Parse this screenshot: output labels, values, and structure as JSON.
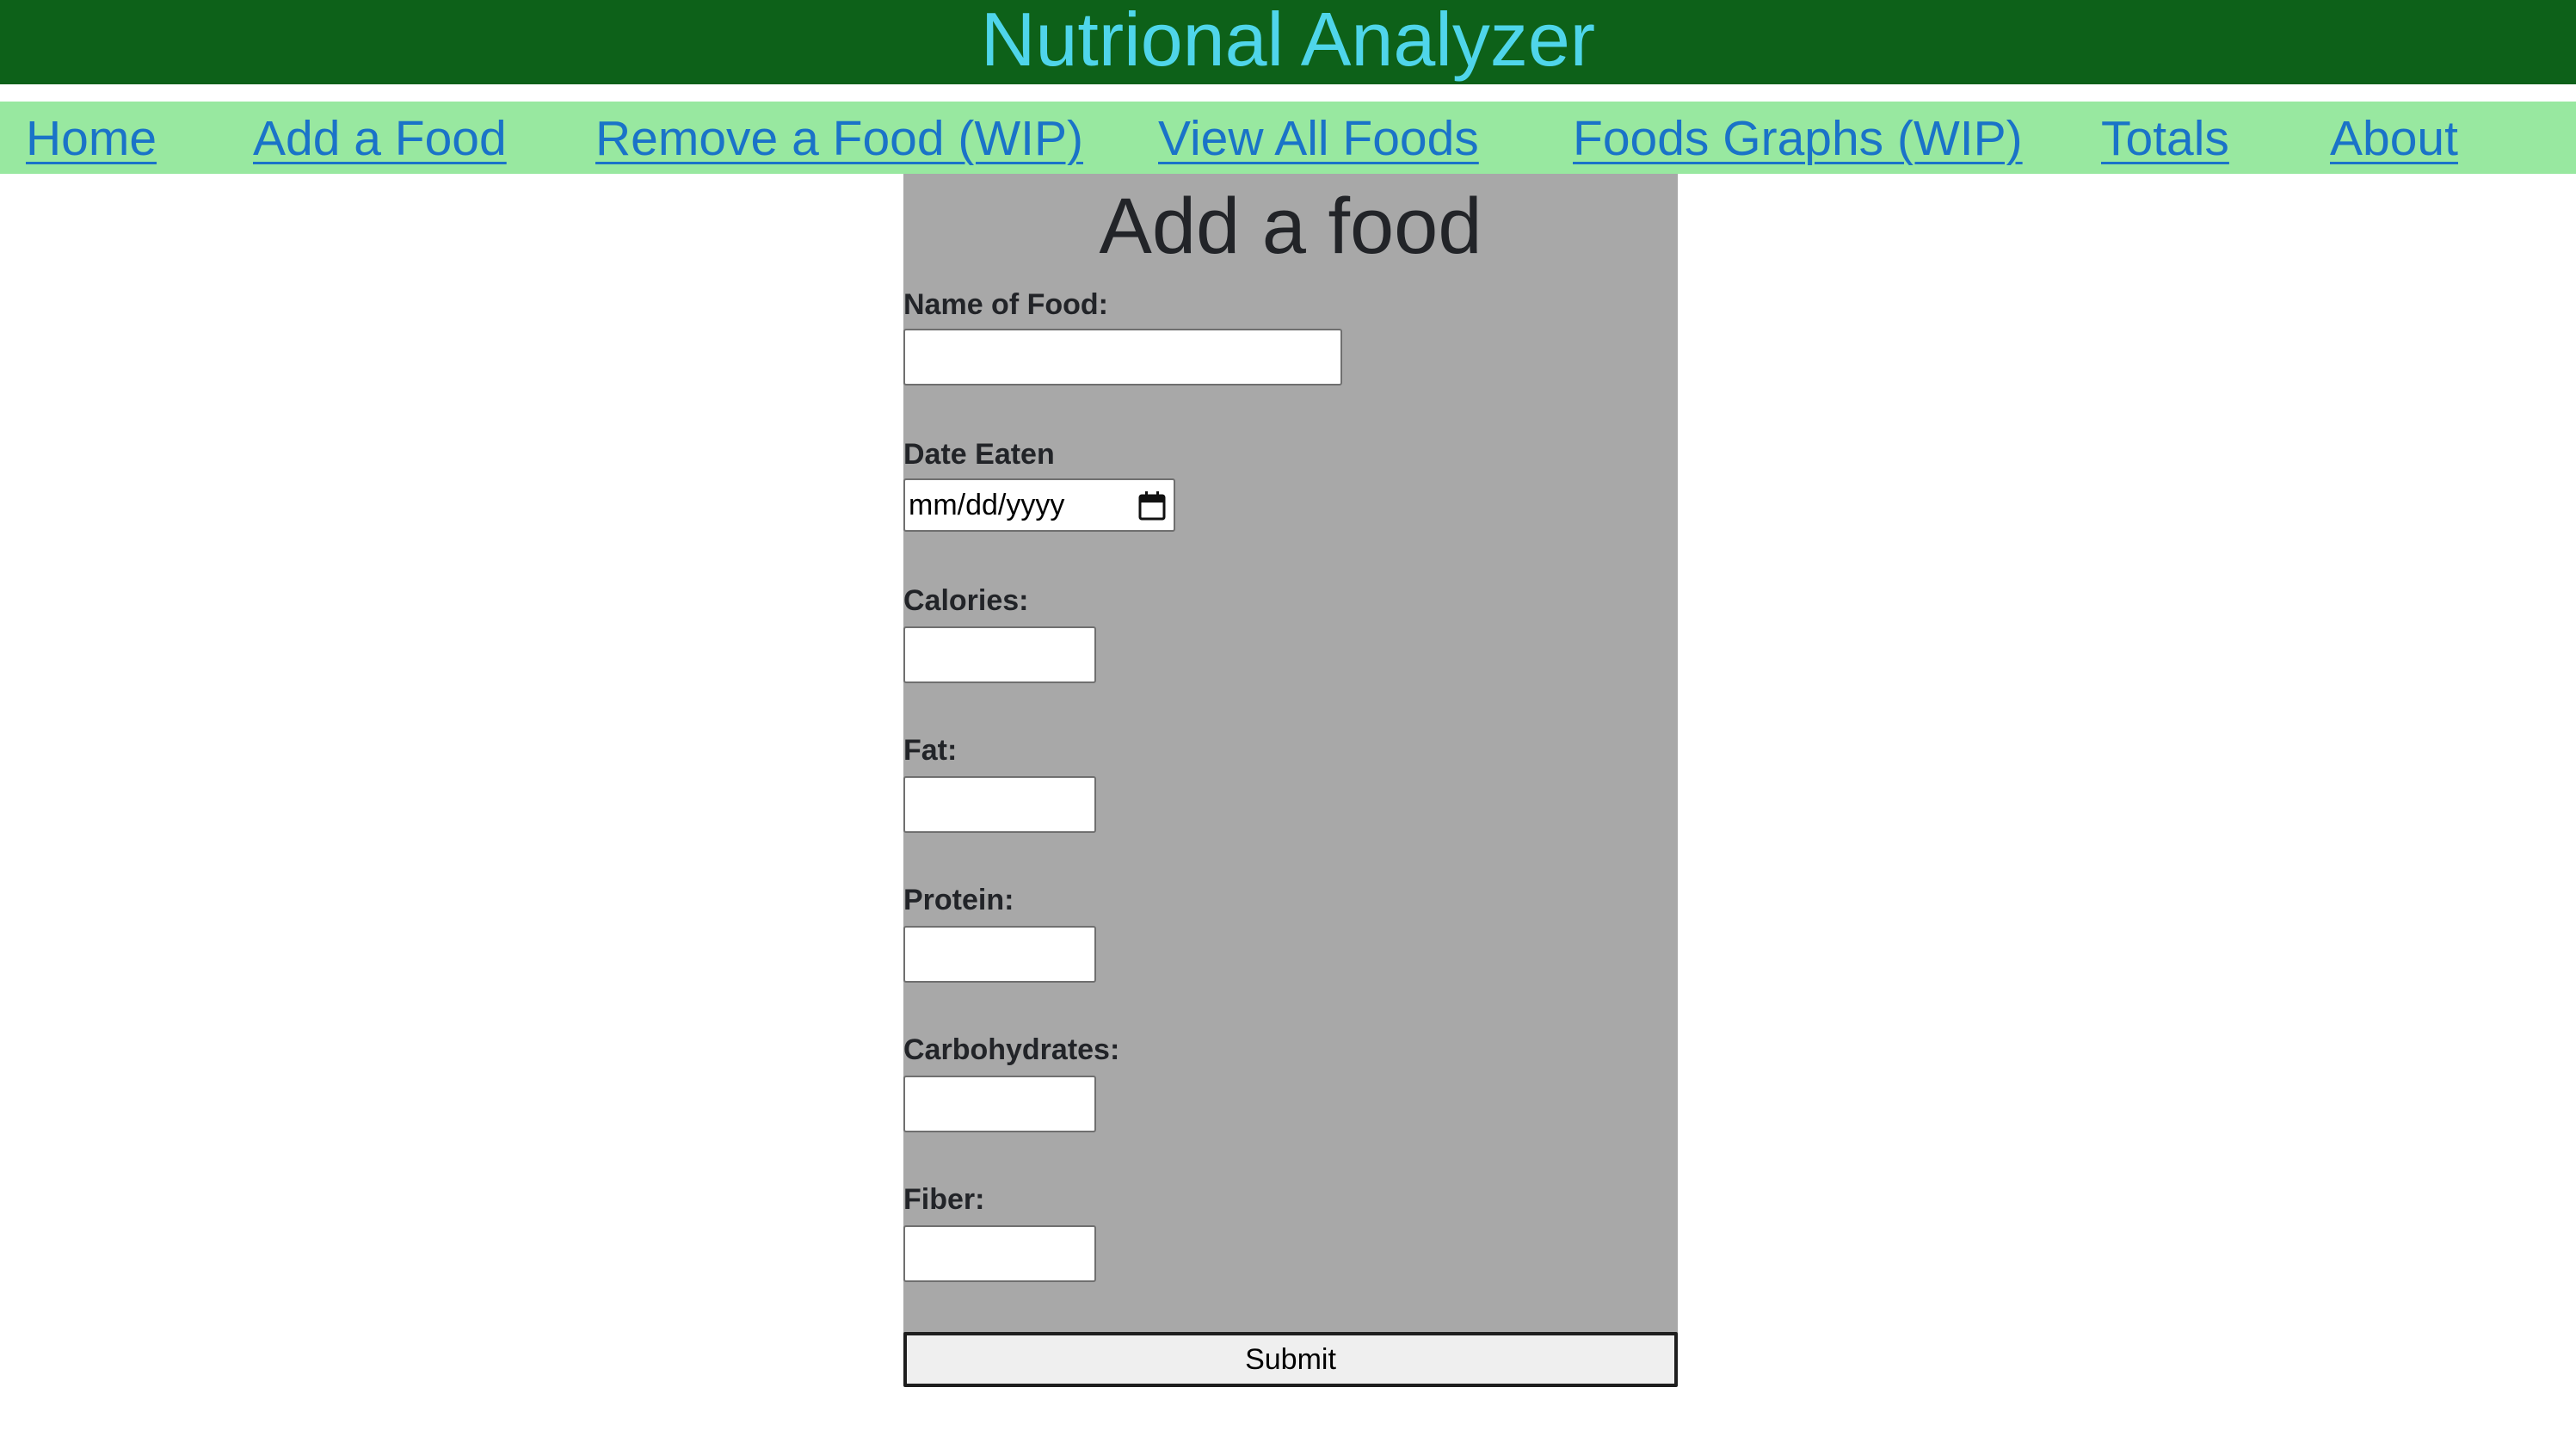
{
  "header": {
    "title": "Nutrional Analyzer"
  },
  "nav": {
    "items": [
      {
        "label": "Home"
      },
      {
        "label": "Add a Food"
      },
      {
        "label": "Remove a Food (WIP)"
      },
      {
        "label": "View All Foods"
      },
      {
        "label": "Foods Graphs (WIP)"
      },
      {
        "label": "Totals"
      },
      {
        "label": "About"
      }
    ]
  },
  "form": {
    "heading": "Add a food",
    "fields": {
      "name": {
        "label": "Name of Food:",
        "value": "",
        "placeholder": ""
      },
      "date": {
        "label": "Date Eaten",
        "placeholder": "mm/dd/yyyy",
        "icon": "calendar-icon"
      },
      "calories": {
        "label": "Calories:",
        "value": "",
        "placeholder": ""
      },
      "fat": {
        "label": "Fat:",
        "value": "",
        "placeholder": ""
      },
      "protein": {
        "label": "Protein:",
        "value": "",
        "placeholder": ""
      },
      "carbohydrates": {
        "label": "Carbohydrates:",
        "value": "",
        "placeholder": ""
      },
      "fiber": {
        "label": "Fiber:",
        "value": "",
        "placeholder": ""
      }
    },
    "submit_label": "Submit"
  },
  "colors": {
    "header_background": "#0d6119",
    "title_color": "#4fd5ea",
    "nav_background": "#98e8a0",
    "link_color": "#1a73c8",
    "panel_background": "#a8a8a8"
  }
}
